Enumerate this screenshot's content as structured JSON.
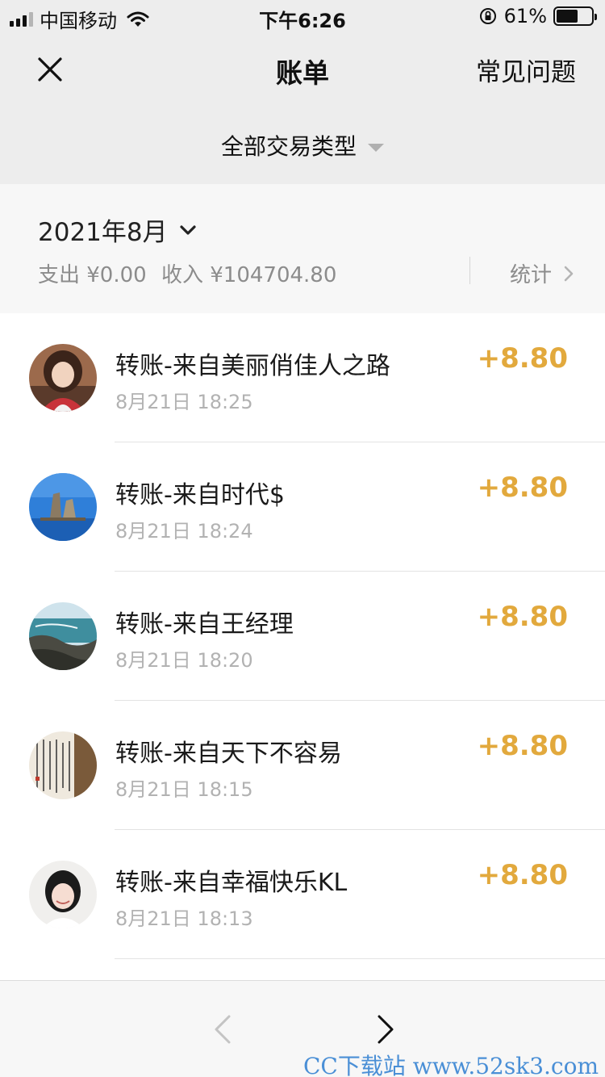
{
  "status_bar": {
    "carrier": "中国移动",
    "time": "下午6:26",
    "battery_text": "61%",
    "battery_level": 0.61
  },
  "nav": {
    "title": "账单",
    "faq_label": "常见问题",
    "filter_label": "全部交易类型"
  },
  "summary": {
    "month": "2021年8月",
    "expense": "支出 ¥0.00",
    "income": "收入 ¥104704.80",
    "stats_label": "统计"
  },
  "transactions": [
    {
      "title": "转账-来自美丽俏佳人之路",
      "time": "8月21日 18:25",
      "amount": "+8.80"
    },
    {
      "title": "转账-来自时代$",
      "time": "8月21日 18:24",
      "amount": "+8.80"
    },
    {
      "title": "转账-来自王经理",
      "time": "8月21日 18:20",
      "amount": "+8.80"
    },
    {
      "title": "转账-来自天下不容易",
      "time": "8月21日 18:15",
      "amount": "+8.80"
    },
    {
      "title": "转账-来自幸福快乐KL",
      "time": "8月21日 18:13",
      "amount": "+8.80"
    }
  ],
  "watermark": "CC下载站 www.52sk3.com",
  "colors": {
    "header_bg": "#ededed",
    "summary_bg": "#f7f7f7",
    "amount": "#e2a93d",
    "watermark": "#4a8fd6"
  },
  "icons": {
    "close": "close-icon",
    "filter_caret": "caret-down-icon",
    "month_chevron": "chevron-down-icon",
    "stats_chevron": "chevron-right-icon",
    "back": "chevron-left-icon",
    "forward": "chevron-right-icon"
  }
}
